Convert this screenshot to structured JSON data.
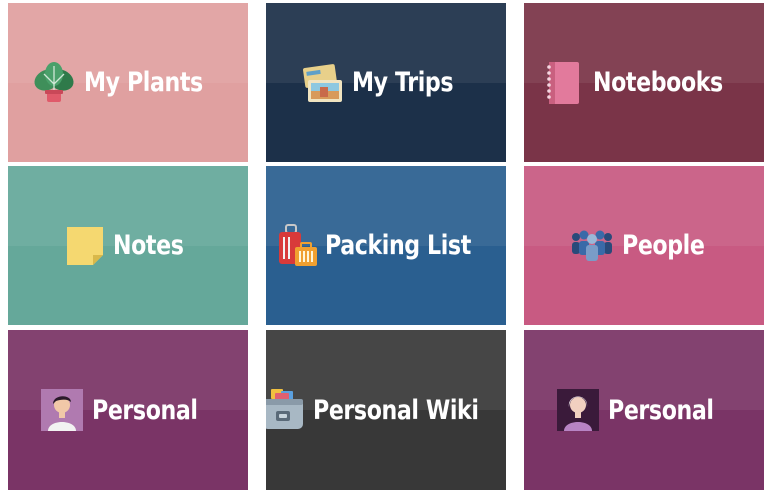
{
  "tiles": [
    {
      "label": "My Plants",
      "color": "#e0a0a0",
      "icon": "plant-icon"
    },
    {
      "label": "My Trips",
      "color": "#1c3049",
      "icon": "travel-postcards-icon"
    },
    {
      "label": "Notebooks",
      "color": "#7a3448",
      "icon": "notebook-icon"
    },
    {
      "label": "Notes",
      "color": "#65a89a",
      "icon": "sticky-note-icon"
    },
    {
      "label": "Packing List",
      "color": "#2a5f90",
      "icon": "luggage-icon"
    },
    {
      "label": "People",
      "color": "#c85a82",
      "icon": "group-people-icon"
    },
    {
      "label": "Personal",
      "color": "#7a3466",
      "icon": "avatar-man-icon"
    },
    {
      "label": "Personal Wiki",
      "color": "#383838",
      "icon": "card-box-icon"
    },
    {
      "label": "Personal",
      "color": "#7a3466",
      "icon": "avatar-woman-icon"
    }
  ]
}
